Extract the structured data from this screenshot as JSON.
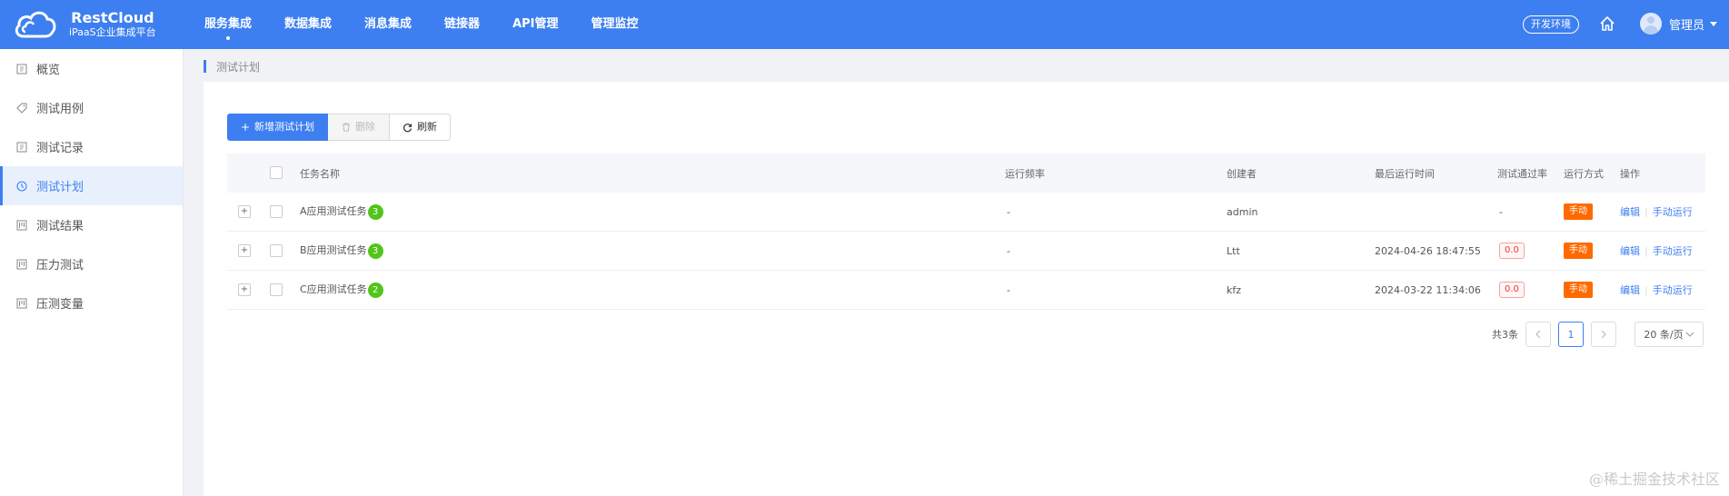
{
  "header": {
    "logo_title": "RestCloud",
    "logo_subtitle": "iPaaS企业集成平台",
    "nav": [
      {
        "label": "服务集成",
        "active": true
      },
      {
        "label": "数据集成",
        "active": false
      },
      {
        "label": "消息集成",
        "active": false
      },
      {
        "label": "链接器",
        "active": false
      },
      {
        "label": "API管理",
        "active": false
      },
      {
        "label": "管理监控",
        "active": false
      }
    ],
    "env_label": "开发环境",
    "user_name": "管理员"
  },
  "sidebar": {
    "items": [
      {
        "label": "概览",
        "icon": "overview-icon",
        "active": false
      },
      {
        "label": "测试用例",
        "icon": "tag-icon",
        "active": false
      },
      {
        "label": "测试记录",
        "icon": "record-icon",
        "active": false
      },
      {
        "label": "测试计划",
        "icon": "clock-icon",
        "active": true
      },
      {
        "label": "测试结果",
        "icon": "result-icon",
        "active": false
      },
      {
        "label": "压力测试",
        "icon": "stress-icon",
        "active": false
      },
      {
        "label": "压测变量",
        "icon": "variable-icon",
        "active": false
      }
    ]
  },
  "breadcrumb": {
    "current": "测试计划"
  },
  "toolbar": {
    "add_label": "新增测试计划",
    "delete_label": "删除",
    "refresh_label": "刷新"
  },
  "table": {
    "columns": {
      "name": "任务名称",
      "frequency": "运行频率",
      "creator": "创建者",
      "last_run": "最后运行时间",
      "pass_rate": "测试通过率",
      "mode": "运行方式",
      "ops": "操作"
    },
    "rows": [
      {
        "name": "A应用测试任务",
        "count": "3",
        "frequency": "-",
        "creator": "admin",
        "last_run": "",
        "pass_rate": "-",
        "pass_rate_badge": false,
        "mode": "手动",
        "edit": "编辑",
        "run": "手动运行"
      },
      {
        "name": "B应用测试任务",
        "count": "3",
        "frequency": "-",
        "creator": "Ltt",
        "last_run": "2024-04-26 18:47:55",
        "pass_rate": "0.0",
        "pass_rate_badge": true,
        "mode": "手动",
        "edit": "编辑",
        "run": "手动运行"
      },
      {
        "name": "C应用测试任务",
        "count": "2",
        "frequency": "-",
        "creator": "kfz",
        "last_run": "2024-03-22 11:34:06",
        "pass_rate": "0.0",
        "pass_rate_badge": true,
        "mode": "手动",
        "edit": "编辑",
        "run": "手动运行"
      }
    ]
  },
  "pagination": {
    "total_text": "共3条",
    "current_page": "1",
    "page_size": "20 条/页"
  },
  "watermark": "@稀土掘金技术社区",
  "colors": {
    "primary": "#3d7ff0",
    "success": "#52c41a",
    "warning": "#ff6a00",
    "danger": "#e53935"
  }
}
